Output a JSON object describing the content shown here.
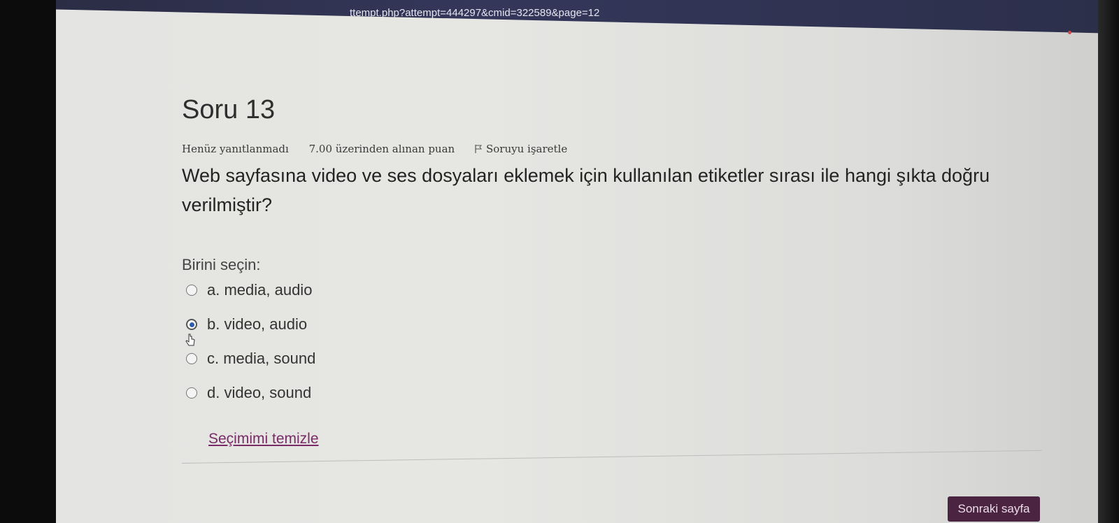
{
  "browser": {
    "url": "ttempt.php?attempt=444297&cmid=322589&page=12"
  },
  "question": {
    "title": "Soru 13",
    "status": "Henüz yanıtlanmadı",
    "points": "7.00 üzerinden alınan puan",
    "flag_label": "Soruyu işaretle",
    "text": "Web sayfasına video ve ses dosyaları eklemek için kullanılan etiketler sırası ile hangi şıkta doğru verilmiştir?",
    "prompt": "Birini seçin:",
    "options": [
      {
        "label": "a. media, audio",
        "selected": false
      },
      {
        "label": "b. video, audio",
        "selected": true
      },
      {
        "label": "c. media, sound",
        "selected": false
      },
      {
        "label": "d. video, sound",
        "selected": false
      }
    ],
    "clear_label": "Seçimimi temizle"
  },
  "navigation": {
    "next_label": "Sonraki sayfa"
  },
  "colors": {
    "button_bg": "#4a2441",
    "link": "#7a2a66",
    "radio_selected": "#2a5db0"
  }
}
